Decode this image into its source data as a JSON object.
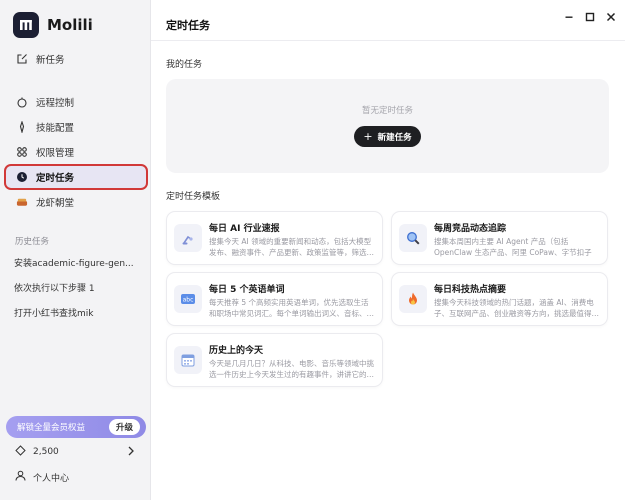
{
  "app": {
    "name": "Molili"
  },
  "sidebar": {
    "new_task": "新任务",
    "items": [
      {
        "label": "远程控制",
        "icon": "remote-icon"
      },
      {
        "label": "技能配置",
        "icon": "skill-icon"
      },
      {
        "label": "权限管理",
        "icon": "permission-icon"
      },
      {
        "label": "定时任务",
        "icon": "clock-icon",
        "active": true
      },
      {
        "label": "龙虾朝堂",
        "icon": "lobster-icon"
      }
    ],
    "history_title": "历史任务",
    "history": [
      "安装academic-figure-gen...",
      "依次执行以下步骤 1",
      "打开小红书查找mik"
    ],
    "vip_text": "解锁全量会员权益",
    "vip_button": "升级",
    "credits": "2,500",
    "profile": "个人中心"
  },
  "main": {
    "title": "定时任务",
    "my_tasks_title": "我的任务",
    "empty_text": "暂无定时任务",
    "new_task_button": "新建任务",
    "templates_title": "定时任务模板",
    "templates": [
      {
        "title": "每日 AI 行业速报",
        "desc": "搜集今天 AI 领域的重要新闻和动态，包括大模型发布、融资事件、产品更新、政策监管等，筛选…",
        "icon": "robot-arm-icon"
      },
      {
        "title": "每周竞品动态追踪",
        "desc": "搜集本周国内主要 AI Agent 产品（包括 OpenClaw 生态产品、阿里 CoPaw、字节扣子等）的最新动…",
        "icon": "magnifier-icon"
      },
      {
        "title": "每日 5 个英语单词",
        "desc": "每天推荐 5 个高频实用英语单词，优先选取生活和职场中常见词汇。每个单词输出词义、音标、…",
        "icon": "abc-icon"
      },
      {
        "title": "每日科技热点摘要",
        "desc": "搜集今天科技领域的热门话题，涵盖 AI、消费电子、互联网产品、创业融资等方向，挑选最值得…",
        "icon": "fire-icon"
      },
      {
        "title": "历史上的今天",
        "desc": "今天是几月几日？从科技、电影、音乐等领域中挑选一件历史上今天发生过的有趣事件，讲讲它的…",
        "icon": "calendar-icon"
      }
    ]
  },
  "colors": {
    "accent": "#8f8ae6",
    "active_outline": "#d13838",
    "dark_button": "#1e1f22"
  }
}
